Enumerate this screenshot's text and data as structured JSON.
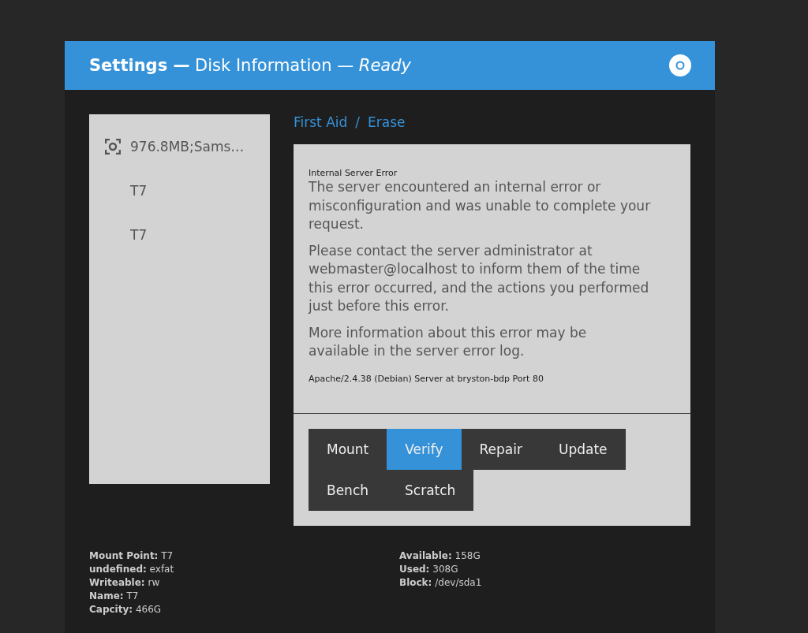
{
  "window": {
    "title": "**Settings —** Disk Information — *Ready*"
  },
  "sidebar": {
    "items": [
      {
        "label": "976.8MB;Sams…",
        "kind": "drive",
        "selected": false
      },
      {
        "label": "T7",
        "kind": "volume",
        "selected": false
      },
      {
        "label": "T7",
        "kind": "volume",
        "selected": false
      }
    ]
  },
  "breadcrumb": {
    "links": [
      "First Aid",
      "Erase"
    ],
    "separator": "/"
  },
  "error": {
    "heading": "Internal Server Error",
    "paragraphs": [
      "The server encountered an internal error or misconfiguration and was unable to complete your request.",
      "Please contact the server administrator at webmaster@localhost to inform them of the time this error occurred, and the actions you performed just before this error.",
      "More information about this error may be available in the server error log."
    ],
    "footer": "Apache/2.4.38 (Debian) Server at bryston-bdp Port 80"
  },
  "actions": [
    [
      {
        "label": "Mount",
        "selected": false
      },
      {
        "label": "Verify",
        "selected": true
      },
      {
        "label": "Repair",
        "selected": false
      },
      {
        "label": "Update",
        "selected": false
      }
    ],
    [
      {
        "label": "Bench",
        "selected": false
      },
      {
        "label": "Scratch",
        "selected": false
      }
    ]
  ],
  "info_left": [
    {
      "label": "Mount Point:",
      "value": "T7"
    },
    {
      "label": "undefined:",
      "value": "exfat"
    },
    {
      "label": "Writeable:",
      "value": "rw"
    },
    {
      "label": "Name:",
      "value": "T7"
    },
    {
      "label": "Capcity:",
      "value": "466G"
    }
  ],
  "info_right": [
    {
      "label": "Available:",
      "value": "158G"
    },
    {
      "label": "Used:",
      "value": "308G"
    },
    {
      "label": "Block:",
      "value": "/dev/sda1"
    }
  ]
}
